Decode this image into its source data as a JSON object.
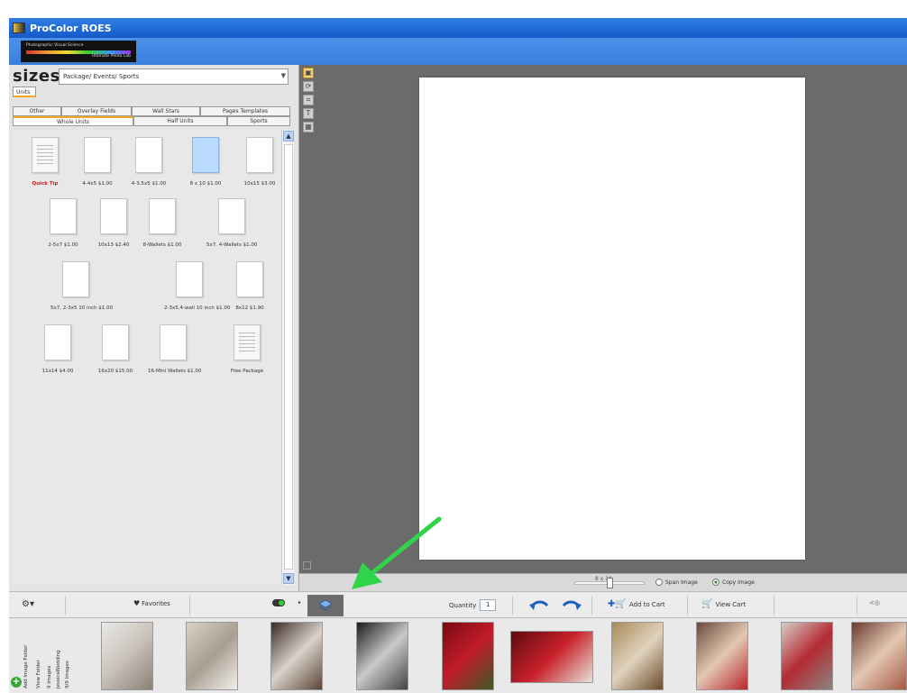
{
  "window": {
    "title": "ProColor ROES"
  },
  "logo": {
    "line1": "Photographic Visual Science",
    "line2": "Ultimate Photo Lab"
  },
  "sizes_panel": {
    "title": "sizes",
    "package_select": "Package/ Events/ Sports",
    "units_tab": "Units",
    "tabs_row1": [
      "Other",
      "Overlay Fields",
      "Wall Stars",
      "Pages Templates"
    ],
    "tabs_row2": [
      "Whole Units",
      "Half Units",
      "Sports"
    ],
    "items": [
      {
        "label": "Quick Tip",
        "kind": "sheet",
        "highlight": true
      },
      {
        "label": "4-4x5 $1.00",
        "kind": "blank"
      },
      {
        "label": "4-3.5x5 $1.00",
        "kind": "blank"
      },
      {
        "label": "8 x 10 $1.00",
        "kind": "selected"
      },
      {
        "label": "10x15 $3.00",
        "kind": "blank"
      },
      {
        "label": "2-5x7 $1.00",
        "kind": "blank"
      },
      {
        "label": "10x13 $2.40",
        "kind": "blank"
      },
      {
        "label": "8-Wallets $1.00",
        "kind": "blank"
      },
      {
        "label": "5x7, 4-Wallets $1.00",
        "kind": "blank"
      },
      {
        "label": "5x7, 2-3x5 10 inch $1.00",
        "kind": "blank"
      },
      {
        "label": "2-3x5,4-wall 10 inch $1.00",
        "kind": "blank"
      },
      {
        "label": "8x12 $1.90",
        "kind": "blank"
      },
      {
        "label": "11x14 $4.00",
        "kind": "blank"
      },
      {
        "label": "16x20 $15.00",
        "kind": "blank"
      },
      {
        "label": "16-Mini Wallets $1.00",
        "kind": "blank"
      },
      {
        "label": "Free Package",
        "kind": "sheet"
      }
    ]
  },
  "canvas": {
    "page_size_label": "8 x 10",
    "span_image": "Span Image",
    "copy_image": "Copy Image",
    "copy_image_selected": true,
    "zoom_fraction": 0.5
  },
  "toolbar": {
    "favorites": "Favorites",
    "quantity_label": "Quantity",
    "quantity_value": "1",
    "add_to_cart": "Add to Cart",
    "view_cart": "View Cart"
  },
  "filmstrip": {
    "add_folder": "Add Image Folder",
    "view_folder": "View Folder",
    "image_count": "9 Images",
    "folder_name": "JessicaWedding",
    "all_images": "9/9 Images",
    "photos": [
      {
        "name": "photo-dress-white",
        "colors": [
          "#e9e9e9",
          "#c9c2b8",
          "#8a8176"
        ]
      },
      {
        "name": "photo-dress-window",
        "colors": [
          "#d8d2c8",
          "#a89f92",
          "#f2efe9"
        ]
      },
      {
        "name": "photo-dress-dark",
        "colors": [
          "#3a2a22",
          "#d9d2ca",
          "#5b4536"
        ]
      },
      {
        "name": "photo-dress-bw",
        "colors": [
          "#1a1a1a",
          "#c9c9c9",
          "#444"
        ]
      },
      {
        "name": "photo-roses",
        "colors": [
          "#7a0a12",
          "#c21c2a",
          "#3b5a24"
        ]
      },
      {
        "name": "photo-roses-shoes",
        "colors": [
          "#5e0b10",
          "#c8202a",
          "#e6e2d9"
        ]
      },
      {
        "name": "photo-bride-mirror",
        "colors": [
          "#a78a5a",
          "#e0d3bd",
          "#6b4b2b"
        ]
      },
      {
        "name": "photo-bride-red",
        "colors": [
          "#6a4a3a",
          "#e2c8b2",
          "#b8262e"
        ]
      },
      {
        "name": "photo-bride-lying",
        "colors": [
          "#d7cfc6",
          "#b42a33",
          "#8a8580"
        ]
      },
      {
        "name": "photo-bride-family",
        "colors": [
          "#6b3a2e",
          "#e3c8b3",
          "#a55a45"
        ]
      }
    ]
  },
  "colors": {
    "accent_arrow": "#2fd44a",
    "title_blue": "#1f6fdc",
    "canvas_grey": "#6b6b6b"
  }
}
